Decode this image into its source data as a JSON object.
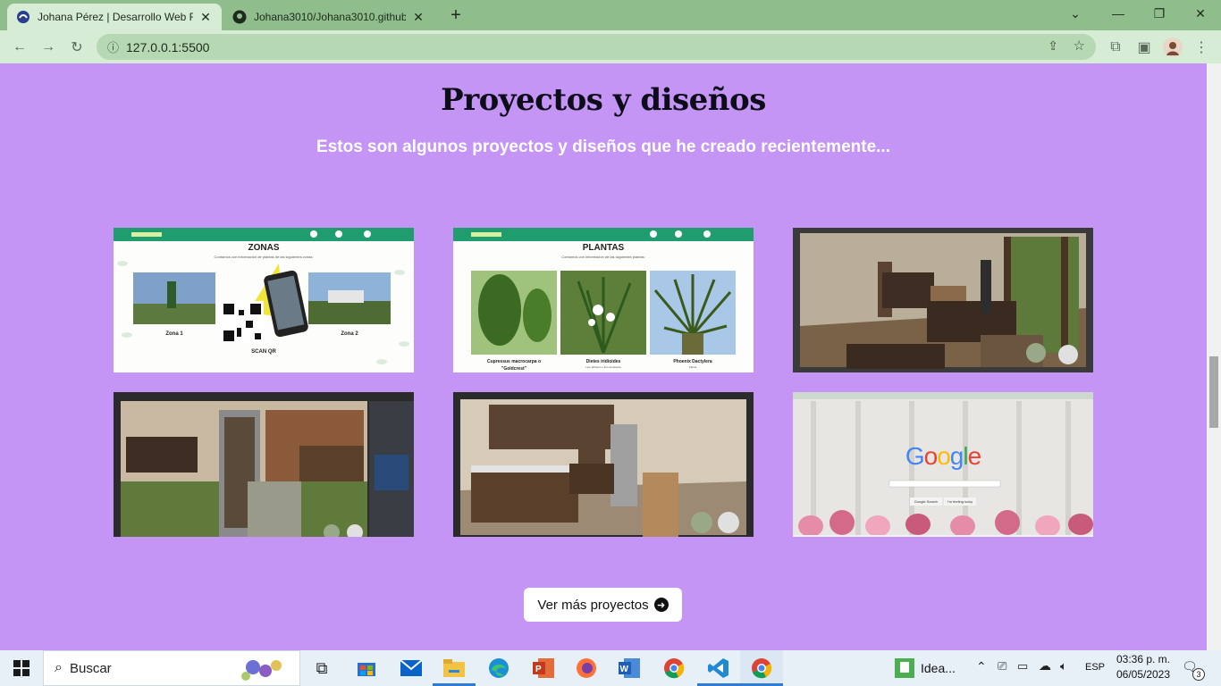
{
  "browser": {
    "tabs": [
      {
        "title": "Johana Pérez | Desarrollo Web Fr",
        "active": true
      },
      {
        "title": "Johana3010/Johana3010.github.i",
        "active": false
      }
    ],
    "url": "127.0.0.1:5500"
  },
  "section": {
    "title": "Proyectos y diseños",
    "subtitle": "Estos son algunos proyectos y diseños que he creado recientemente..."
  },
  "projects": {
    "zonas": {
      "header": "ZONAS",
      "intro": "Contamos con información de plantas de las siguientes zonas:",
      "zona1": "Zona 1",
      "zona2": "Zona 2",
      "scan": "SCAN QR"
    },
    "plantas": {
      "header": "PLANTAS",
      "intro": "Contamos con información de las siguientes plantas:",
      "p1": "Cupressus macrocarpa o",
      "p1b": "\"Goldcrest\"",
      "p2": "Dietes iridioides",
      "p2b": "Lirio africano o lirio de Etiopia",
      "p3": "Phoenix Dactylera",
      "p3b": "Palma"
    },
    "google": {
      "logo": "Google",
      "btn1": "Google Search",
      "btn2": "I'm feeling lucky"
    }
  },
  "cta": {
    "label": "Ver más proyectos"
  },
  "taskbar": {
    "search": "Buscar",
    "idea": "Idea...",
    "lang": "ESP",
    "time": "03:36 p. m.",
    "date": "06/05/2023",
    "notifications": "3"
  }
}
